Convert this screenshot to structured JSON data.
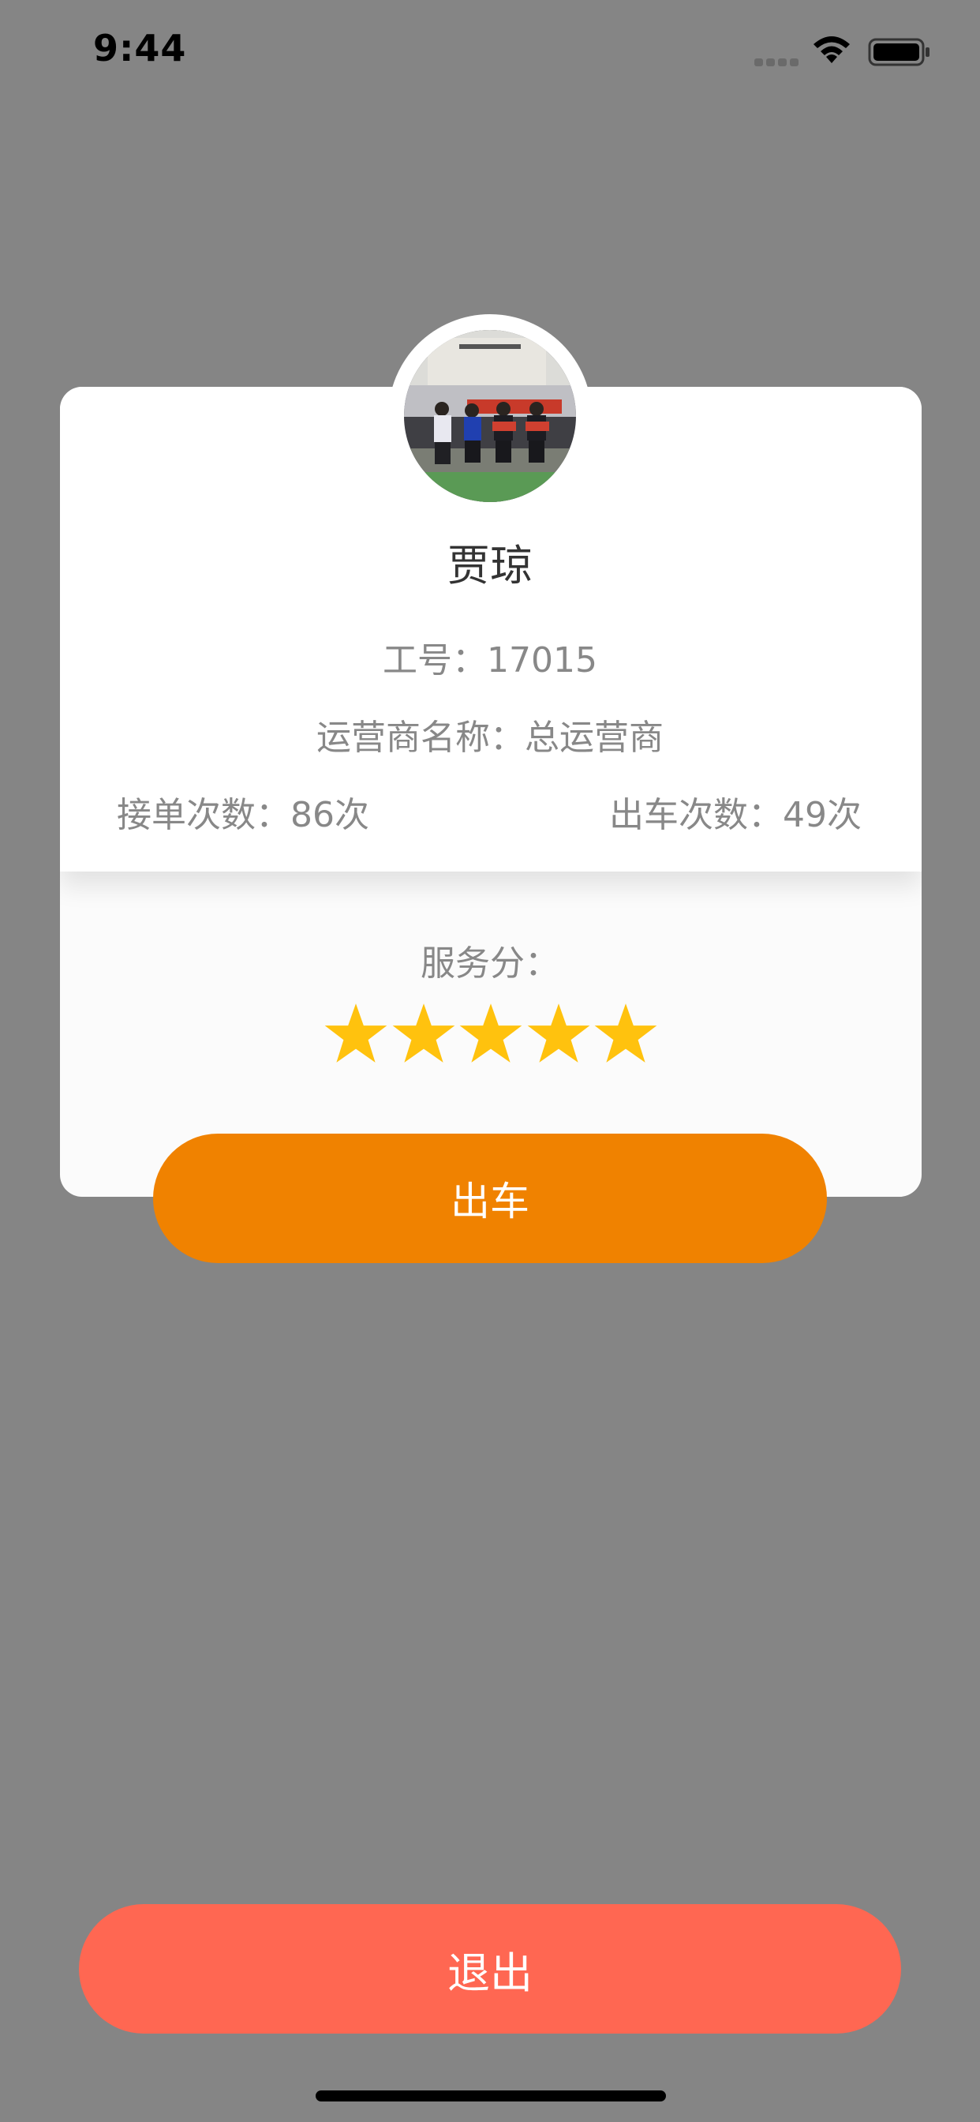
{
  "status_bar": {
    "time": "9:44"
  },
  "profile": {
    "name": "贾琼",
    "employee_id": "工号：17015",
    "operator": "运营商名称：总运营商",
    "order_count": "接单次数：86次",
    "dispatch_count": "出车次数：49次",
    "service_score_label": "服务分：",
    "rating": {
      "value": 5,
      "max": 5
    }
  },
  "actions": {
    "dispatch_label": "出车",
    "logout_label": "退出"
  },
  "colors": {
    "background_overlay": "#858585",
    "dispatch_button": "#f08200",
    "logout_button": "#ff6752",
    "star": "#ffc20e"
  },
  "icons": {
    "signal": "cellular-signal-icon",
    "wifi": "wifi-icon",
    "battery": "battery-icon",
    "star": "star-icon"
  }
}
